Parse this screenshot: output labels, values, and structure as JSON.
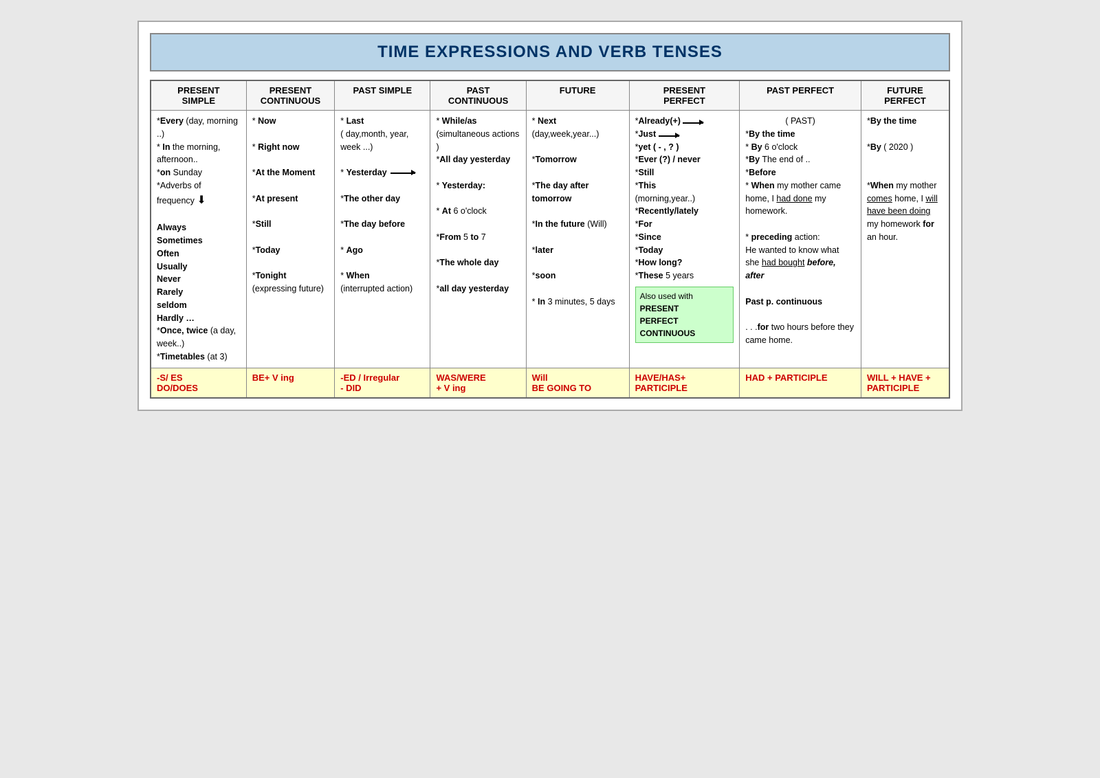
{
  "page": {
    "title": "TIME EXPRESSIONS AND VERB TENSES",
    "columns": [
      {
        "id": "present_simple",
        "header_line1": "PRESENT",
        "header_line2": "SIMPLE"
      },
      {
        "id": "present_cont",
        "header_line1": "PRESENT",
        "header_line2": "CONTINUOUS"
      },
      {
        "id": "past_simple",
        "header_line1": "PAST SIMPLE",
        "header_line2": ""
      },
      {
        "id": "past_cont",
        "header_line1": "PAST",
        "header_line2": "CONTINUOUS"
      },
      {
        "id": "future",
        "header_line1": "FUTURE",
        "header_line2": ""
      },
      {
        "id": "present_perf",
        "header_line1": "PRESENT",
        "header_line2": "PERFECT"
      },
      {
        "id": "past_perf",
        "header_line1": "PAST PERFECT",
        "header_line2": ""
      },
      {
        "id": "future_perf",
        "header_line1": "FUTURE",
        "header_line2": "PERFECT"
      }
    ],
    "bottom_row": [
      "-S/ ES\nDO/DOES",
      "BE+ V ing",
      "-ED / Irregular\n- DID",
      "WAS/WERE\n+ V ing",
      "Will\nBE GOING TO",
      "HAVE/HAS+\nPARTICIPLE",
      "HAD + PARTICIPLE",
      "WILL + HAVE +\nPARTICIPLE"
    ]
  }
}
